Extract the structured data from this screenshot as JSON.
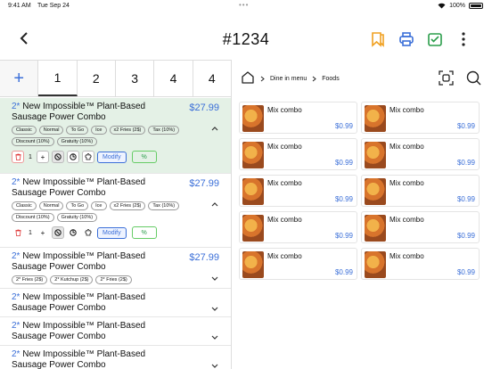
{
  "status_bar": {
    "time": "9:41 AM",
    "date": "Tue Sep 24",
    "battery": "100%"
  },
  "header": {
    "title": "#1234",
    "back_icon": "chevron-left-icon"
  },
  "tabs": [
    {
      "label": "+"
    },
    {
      "label": "1"
    },
    {
      "label": "2"
    },
    {
      "label": "3"
    },
    {
      "label": "4"
    },
    {
      "label": "4"
    }
  ],
  "breadcrumb": {
    "level1": "Dine in menu",
    "level2": "Foods"
  },
  "orders": [
    {
      "qty": "2*",
      "name": "New Impossible™ Plant-Based Sausage Power Combo",
      "price": "$27.99",
      "chips": [
        "Classic",
        "Normal",
        "To Go",
        "Ice",
        "x2 Fries (2$)",
        "Tax (10%)",
        "Discount (10%)",
        "Gratuity (10%)"
      ],
      "count": "1",
      "modify": "Modify",
      "percent": "%"
    },
    {
      "qty": "2*",
      "name": "New Impossible™ Plant-Based Sausage Power Combo",
      "price": "$27.99",
      "chips": [
        "Classic",
        "Normal",
        "To Go",
        "Ice",
        "x2 Fries (2$)",
        "Tax (10%)",
        "Discount (10%)",
        "Gratuity (10%)"
      ],
      "count": "1",
      "modify": "Modify",
      "percent": "%"
    },
    {
      "qty": "2*",
      "name": "New Impossible™ Plant-Based Sausage Power Combo",
      "price": "$27.99",
      "chips": [
        "2* Fries (2$)",
        "2* Kutchup (2$)",
        "2* Fries (2$)"
      ]
    },
    {
      "qty": "2*",
      "name": "New Impossible™ Plant-Based Sausage Power Combo"
    },
    {
      "qty": "2*",
      "name": "New Impossible™ Plant-Based Sausage Power Combo"
    },
    {
      "qty": "2*",
      "name": "New Impossible™ Plant-Based Sausage Power Combo"
    }
  ],
  "menu_items": [
    {
      "name": "Mix combo",
      "price": "$0.99"
    },
    {
      "name": "Mix combo",
      "price": "$0.99"
    },
    {
      "name": "Mix combo",
      "price": "$0.99"
    },
    {
      "name": "Mix combo",
      "price": "$0.99"
    },
    {
      "name": "Mix combo",
      "price": "$0.99"
    },
    {
      "name": "Mix combo",
      "price": "$0.99"
    },
    {
      "name": "Mix combo",
      "price": "$0.99"
    },
    {
      "name": "Mix combo",
      "price": "$0.99"
    },
    {
      "name": "Mix combo",
      "price": "$0.99"
    },
    {
      "name": "Mix combo",
      "price": "$0.99"
    }
  ],
  "colors": {
    "accent": "#3b6fd8",
    "selected_bg": "#e4f1e6",
    "icon_orange": "#f0a020",
    "icon_green": "#2a9d4a"
  }
}
